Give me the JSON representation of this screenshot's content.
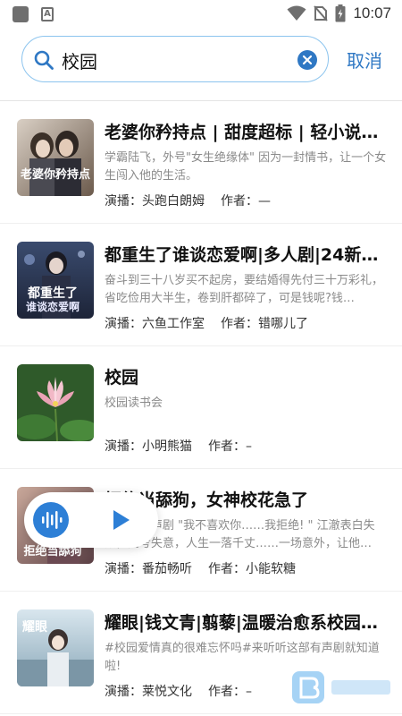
{
  "status_bar": {
    "time": "10:07"
  },
  "search": {
    "query": "校园",
    "cancel_label": "取消"
  },
  "results": [
    {
      "title": "老婆你矜持点 | 甜度超标 | 轻小说&…",
      "description": "学霸陆飞，外号\"女生绝缘体\" 因为一封情书，让一个女生闯入他的生活。",
      "narrator_label": "演播：",
      "narrator": "头跑白朗姆",
      "author_label": "作者：",
      "author": "—",
      "cover_text": "老婆你矜持点"
    },
    {
      "title": "都重生了谁谈恋爱啊|多人剧|24新…",
      "description": "奋斗到三十八岁买不起房，要结婚得先付三十万彩礼，省吃俭用大半生，卷到肝都碎了，可是钱呢?钱…",
      "narrator_label": "演播：",
      "narrator": "六鱼工作室",
      "author_label": "作者：",
      "author": "错哪儿了",
      "cover_text": "都重生了谁谈恋爱啊"
    },
    {
      "title": "校园",
      "description": "校园读书会",
      "narrator_label": "演播：",
      "narrator": "小明熊猫",
      "author_label": "作者：",
      "author": "–",
      "cover_text": ""
    },
    {
      "title": "拒绝当舔狗，女神校花急了",
      "description": "……站有声剧 \"我不喜欢你……我拒绝! \" 江澈表白失败，高考失意，人生一落千丈……一场意外，让他…",
      "narrator_label": "演播：",
      "narrator": "番茄畅听",
      "author_label": "作者：",
      "author": "小能软糖",
      "cover_text": "拒绝当舔狗"
    },
    {
      "title": "耀眼|钱文青|翦藜|温暖治愈系校园…",
      "description": "#校园爱情真的很难忘怀吗#来听听这部有声剧就知道啦!",
      "narrator_label": "演播：",
      "narrator": "莱悦文化",
      "author_label": "作者：",
      "author": "–",
      "cover_text": "耀眼"
    }
  ],
  "colors": {
    "accent": "#2f78c4",
    "search_border": "#8cc4ee",
    "player": "#2d7fd6"
  },
  "icons": [
    "search-icon",
    "clear-icon",
    "wifi-icon",
    "battery-icon",
    "play-icon",
    "audio-wave-icon"
  ]
}
